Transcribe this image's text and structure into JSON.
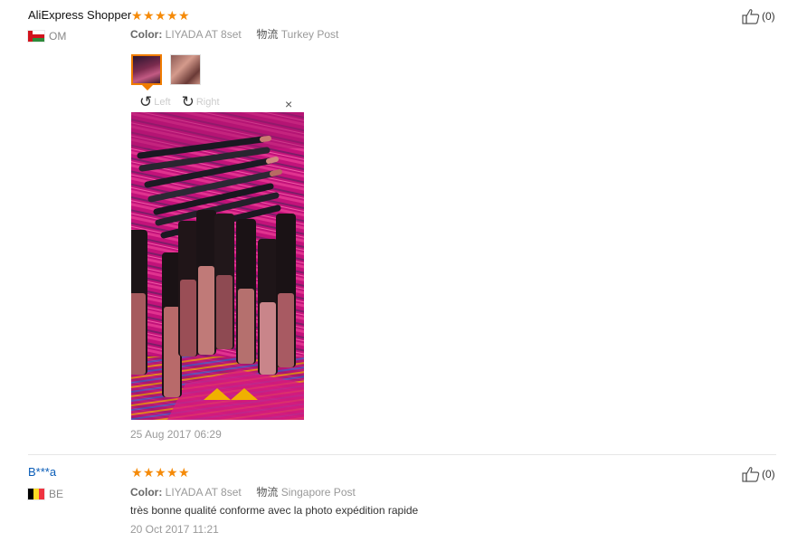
{
  "reviews": [
    {
      "author": "AliExpress Shopper",
      "country": "OM",
      "rating": 5,
      "color_label": "Color:",
      "color_value": "LIYADA AT 8set",
      "shipping_label": "物流",
      "shipping_value": "Turkey Post",
      "viewer": {
        "left_label": "Left",
        "right_label": "Right",
        "close": "×"
      },
      "date": "25 Aug 2017 06:29",
      "likes": "(0)"
    },
    {
      "author": "B***a",
      "country": "BE",
      "rating": 5,
      "color_label": "Color:",
      "color_value": "LIYADA AT 8set",
      "shipping_label": "物流",
      "shipping_value": "Singapore Post",
      "text": "très bonne qualité conforme avec la photo expédition rapide",
      "date": "20 Oct 2017 11:21",
      "likes": "(0)"
    }
  ],
  "icons": {
    "star": "star-icon",
    "thumb": "thumbs-up-icon",
    "rotate_left": "rotate-left-icon",
    "rotate_right": "rotate-right-icon"
  },
  "colors": {
    "star": "#f58a08",
    "author_link": "#0a5db8",
    "active_thumb_border": "#f07c00"
  }
}
